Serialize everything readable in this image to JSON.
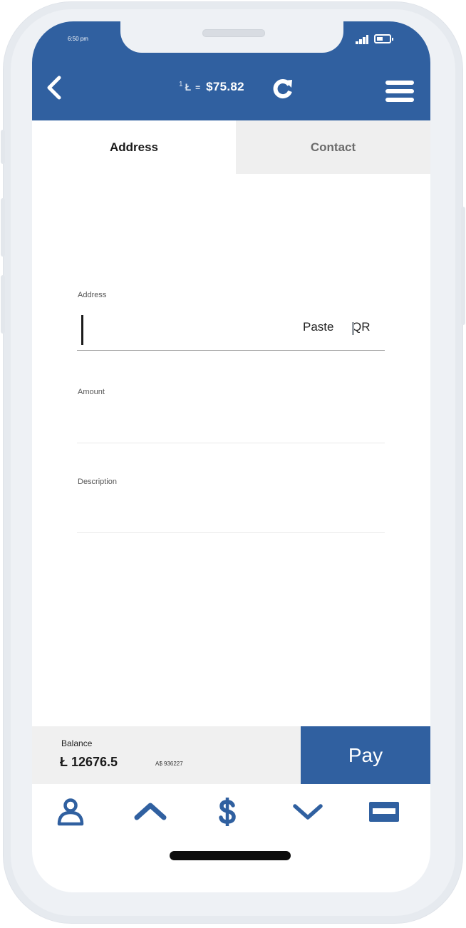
{
  "status_bar": {
    "time": "6:50 pm",
    "battery_level": 0.5
  },
  "header": {
    "back_icon": "chevron-left-icon",
    "rate_unit": "1",
    "rate_currency_symbol": "Ł",
    "rate_equals": "=",
    "rate_value": "$75.82",
    "refresh_icon": "refresh-icon",
    "menu_icon": "hamburger-menu-icon"
  },
  "tabs": [
    {
      "label": "Address",
      "active": true
    },
    {
      "label": "Contact",
      "active": false
    }
  ],
  "form": {
    "address": {
      "label": "Address",
      "value": "",
      "paste_label": "Paste",
      "qr_label": "QR"
    },
    "amount": {
      "label": "Amount",
      "value": ""
    },
    "description": {
      "label": "Description",
      "value": ""
    }
  },
  "balance": {
    "label": "Balance",
    "value": "Ł 12676.5",
    "fiat": "A$ 936227"
  },
  "pay_button": {
    "label": "Pay"
  },
  "bottom_nav": [
    "user-icon",
    "chevron-up-icon",
    "dollar-icon",
    "chevron-down-icon",
    "credit-card-icon"
  ],
  "colors": {
    "accent": "#3060a0",
    "tab_inactive_bg": "#efefef",
    "balance_bg": "#f0f0f0"
  }
}
